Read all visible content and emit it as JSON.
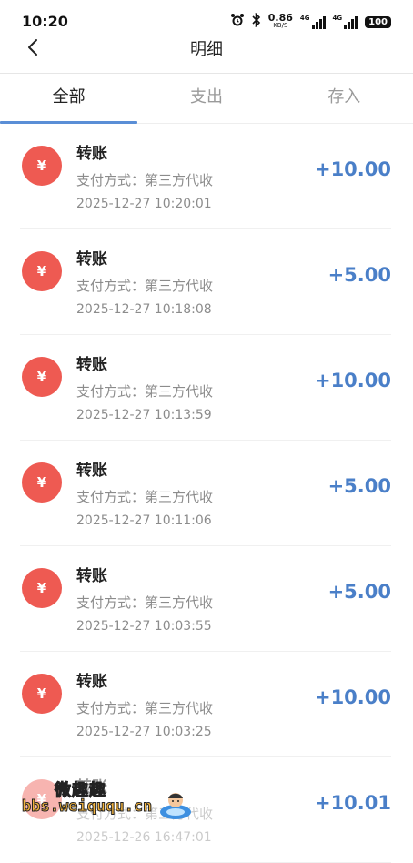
{
  "status_bar": {
    "time": "10:20",
    "net_speed_value": "0.86",
    "net_speed_unit": "KB/S",
    "signal_1_label": "4G",
    "signal_2_label": "4G",
    "battery": "100"
  },
  "nav": {
    "title": "明细"
  },
  "tabs": [
    {
      "label": "全部",
      "active": true
    },
    {
      "label": "支出",
      "active": false
    },
    {
      "label": "存入",
      "active": false
    }
  ],
  "transactions": [
    {
      "icon": "¥",
      "title": "转账",
      "method": "支付方式：第三方代收",
      "time": "2025-12-27 10:20:01",
      "amount": "+10.00"
    },
    {
      "icon": "¥",
      "title": "转账",
      "method": "支付方式：第三方代收",
      "time": "2025-12-27 10:18:08",
      "amount": "+5.00"
    },
    {
      "icon": "¥",
      "title": "转账",
      "method": "支付方式：第三方代收",
      "time": "2025-12-27 10:13:59",
      "amount": "+10.00"
    },
    {
      "icon": "¥",
      "title": "转账",
      "method": "支付方式：第三方代收",
      "time": "2025-12-27 10:11:06",
      "amount": "+5.00"
    },
    {
      "icon": "¥",
      "title": "转账",
      "method": "支付方式：第三方代收",
      "time": "2025-12-27 10:03:55",
      "amount": "+5.00"
    },
    {
      "icon": "¥",
      "title": "转账",
      "method": "支付方式：第三方代收",
      "time": "2025-12-27 10:03:25",
      "amount": "+10.00"
    },
    {
      "icon": "¥",
      "title": "转账",
      "method": "支付方式：第三方代收",
      "time": "2025-12-26 16:47:01",
      "amount": "+10.01"
    }
  ],
  "watermark": {
    "text_cn": "微趣趣",
    "url": "bbs.weiququ.cn"
  },
  "colors": {
    "accent": "#5a8ed6",
    "amount": "#4a7fc8",
    "icon_bg": "#ee5a52"
  }
}
